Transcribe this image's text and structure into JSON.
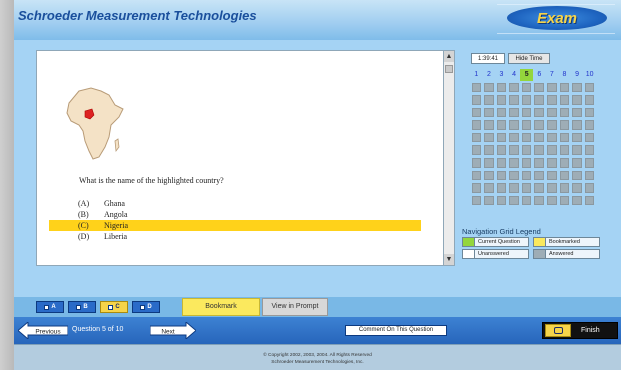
{
  "header": {
    "title": "Schroeder Measurement Technologies",
    "exam_label": "Exam"
  },
  "question": {
    "text": "What is the name of the highlighted country?",
    "options": [
      {
        "letter": "(A)",
        "text": "Ghana",
        "selected": false
      },
      {
        "letter": "(B)",
        "text": "Angola",
        "selected": false
      },
      {
        "letter": "(C)",
        "text": "Nigeria",
        "selected": true
      },
      {
        "letter": "(D)",
        "text": "Liberia",
        "selected": false
      }
    ]
  },
  "timer": {
    "time": "1:39:41",
    "hide_label": "Hide Time"
  },
  "grid": {
    "numbers": [
      "1",
      "2",
      "3",
      "4",
      "5",
      "6",
      "7",
      "8",
      "9",
      "10"
    ],
    "current_index": 4,
    "rows": 10
  },
  "legend": {
    "title": "Navigation Grid Legend",
    "items": [
      {
        "label": "Current Question",
        "color": "#94d63c"
      },
      {
        "label": "Bookmarked",
        "color": "#fbe95e"
      },
      {
        "label": "Unanswered",
        "color": "#ffffff"
      },
      {
        "label": "Answered",
        "color": "#9eadb6"
      }
    ]
  },
  "answer_buttons": [
    {
      "label": "A",
      "selected": false
    },
    {
      "label": "B",
      "selected": false
    },
    {
      "label": "C",
      "selected": true
    },
    {
      "label": "D",
      "selected": false
    }
  ],
  "toolbar": {
    "bookmark_label": "Bookmark",
    "view_prompt_label": "View in Prompt"
  },
  "nav": {
    "previous_label": "Previous",
    "question_of": "Question 5 of 10",
    "next_label": "Next",
    "comment_label": "Comment On This Question",
    "finish_label": "Finish"
  },
  "footer": {
    "line1": "© Copyright 2002, 2003, 2004. All Rights Reserved",
    "line2": "Schroeder Measurement Technologies, Inc."
  },
  "colors": {
    "accent_blue": "#2765bb",
    "highlight_yellow": "#ffd21a",
    "panel_blue": "#a5d3f4"
  }
}
